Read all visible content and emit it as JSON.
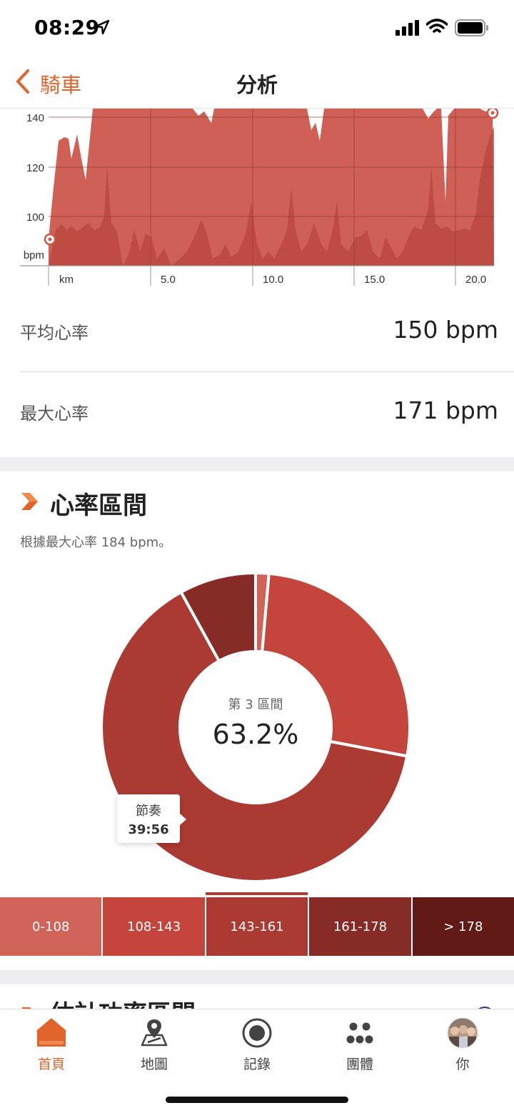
{
  "status_bar": {
    "time": "08:29"
  },
  "nav": {
    "back_label": "騎車",
    "title": "分析"
  },
  "hr_chart": {
    "y_ticks": [
      "140",
      "120",
      "100",
      "bpm"
    ],
    "x_ticks": [
      "km",
      "5.0",
      "10.0",
      "15.0",
      "20.0"
    ]
  },
  "stats": {
    "avg_label": "平均心率",
    "avg_value": "150 bpm",
    "max_label": "最大心率",
    "max_value": "171 bpm"
  },
  "zones": {
    "title": "心率區間",
    "subtitle": "根據最大心率 184 bpm。",
    "center_label": "第 3 區間",
    "center_value": "63.2%",
    "tooltip_label": "節奏",
    "tooltip_value": "39:56",
    "buckets": [
      "0-108",
      "108-143",
      "143-161",
      "161-178",
      "> 178"
    ],
    "colors": [
      "#d16459",
      "#c4453b",
      "#ab3a32",
      "#872b27",
      "#621a16"
    ]
  },
  "next_section": {
    "title": "估計功率區間"
  },
  "tabs": [
    {
      "label": "首頁",
      "icon": "home-icon"
    },
    {
      "label": "地圖",
      "icon": "map-icon"
    },
    {
      "label": "記錄",
      "icon": "record-icon"
    },
    {
      "label": "團體",
      "icon": "groups-icon"
    },
    {
      "label": "你",
      "icon": "avatar-icon"
    }
  ],
  "accent_color": "#e0642c"
}
